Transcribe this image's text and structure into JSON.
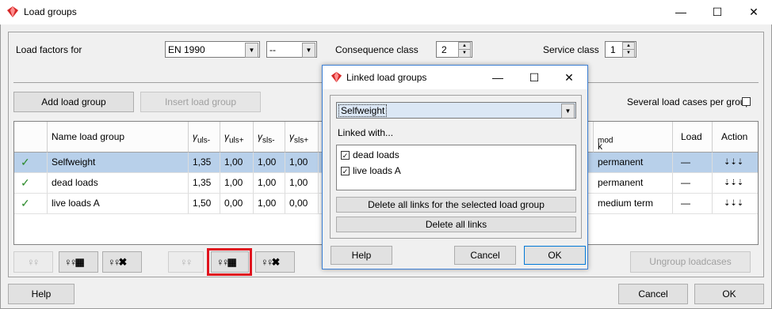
{
  "window": {
    "title": "Load groups",
    "minimize": "—",
    "maximize": "☐",
    "close": "✕"
  },
  "top": {
    "load_factors_label": "Load factors for",
    "standard_value": "EN 1990",
    "subset_value": "--",
    "consequence_label": "Consequence class",
    "consequence_value": "2",
    "service_label": "Service class",
    "service_value": "1"
  },
  "actions": {
    "add_load_group": "Add load group",
    "insert_load_group": "Insert load group",
    "several_load_cases": "Several load cases per group"
  },
  "table": {
    "headers": {
      "name": "Name load group",
      "g_uls_minus": "uls-",
      "g_uls_plus": "uls+",
      "g_sls_minus": "sls-",
      "g_sls_plus": "sls+",
      "kmod_k": "k",
      "kmod_sub": "mod",
      "load": "Load",
      "action": "Action"
    },
    "gamma_symbol": "γ",
    "rows": [
      {
        "check": "✓",
        "name": "Selfweight",
        "uls_minus": "1,35",
        "uls_plus": "1,00",
        "sls_minus": "1,00",
        "sls_plus": "1,00",
        "kmod": "permanent",
        "load": "—",
        "action": "⇣⇣⇣"
      },
      {
        "check": "✓",
        "name": "dead loads",
        "uls_minus": "1,35",
        "uls_plus": "1,00",
        "sls_minus": "1,00",
        "sls_plus": "1,00",
        "kmod": "permanent",
        "load": "—",
        "action": "⇣⇣⇣"
      },
      {
        "check": "✓",
        "name": "live loads A",
        "uls_minus": "1,50",
        "uls_plus": "0,00",
        "sls_minus": "1,00",
        "sls_plus": "0,00",
        "kmod": "medium term",
        "load": "—",
        "action": "⇣⇣⇣"
      }
    ]
  },
  "toolbar": {
    "ungroup": "Ungroup loadcases"
  },
  "footer": {
    "help": "Help",
    "cancel": "Cancel",
    "ok": "OK"
  },
  "dialog": {
    "title": "Linked load groups",
    "minimize": "—",
    "maximize": "☐",
    "close": "✕",
    "group_value": "Selfweight",
    "linked_with": "Linked with...",
    "items": [
      {
        "label": "dead loads",
        "checked": "✓"
      },
      {
        "label": "live loads A",
        "checked": "✓"
      }
    ],
    "delete_selected": "Delete all links for the selected load group",
    "delete_all": "Delete all links",
    "help": "Help",
    "cancel": "Cancel",
    "ok": "OK"
  },
  "colors": {
    "accent": "#3c7fd4",
    "selection": "#b8d0ea",
    "highlight": "#e0141e",
    "check": "#2b8a2b"
  }
}
